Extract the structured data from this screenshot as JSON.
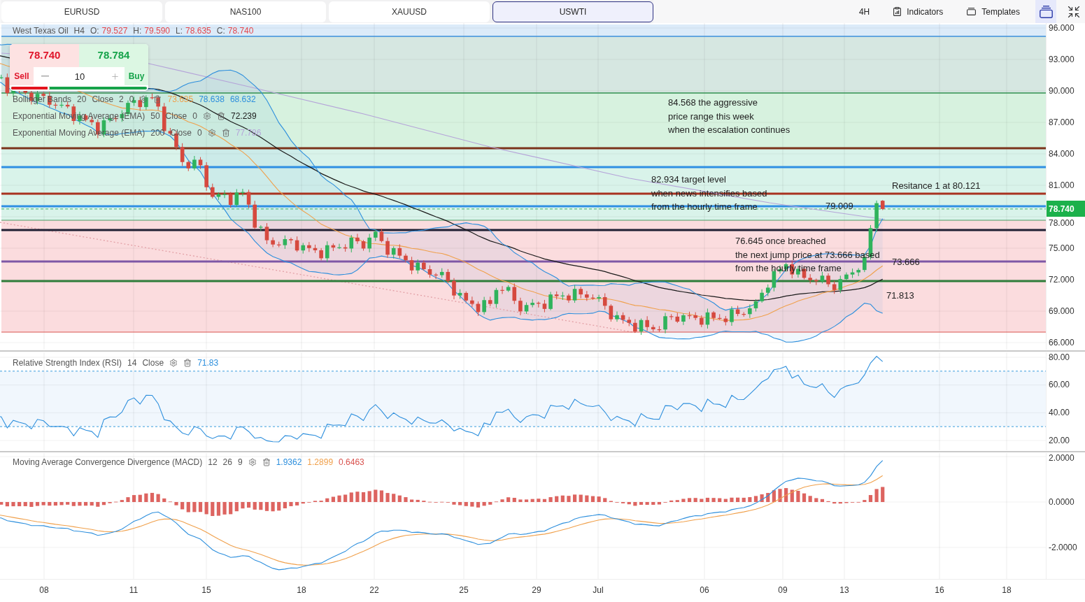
{
  "symbol_tabs": [
    {
      "label": "EURUSD",
      "selected": false
    },
    {
      "label": "NAS100",
      "selected": false
    },
    {
      "label": "XAUUSD",
      "selected": false
    },
    {
      "label": "USWTI",
      "selected": true
    }
  ],
  "toolbar": {
    "interval": "4H",
    "buttons": [
      {
        "kind": "indicators",
        "label": "Indicators"
      },
      {
        "kind": "templates",
        "label": "Templates"
      }
    ],
    "icon_buttons": [
      {
        "kind": "layers",
        "selected": true
      },
      {
        "kind": "collapse",
        "selected": false
      }
    ]
  },
  "instrument_legend": {
    "name": "West Texas Oil",
    "interval": "H4",
    "ohlc": [
      {
        "label": "O:",
        "value": "79.527"
      },
      {
        "label": "H:",
        "value": "79.590"
      },
      {
        "label": "L:",
        "value": "78.635"
      },
      {
        "label": "C:",
        "value": "78.740"
      }
    ]
  },
  "trade_panel": {
    "sell_price": "78.740",
    "buy_price": "78.784",
    "sell_label": "Sell",
    "buy_label": "Buy",
    "quantity": "10",
    "sentiment": {
      "level": 0.27
    }
  },
  "indicator_legends": [
    {
      "name": "Bollinger Bands",
      "params": [
        "20",
        "Close",
        "2",
        "0"
      ],
      "values": [
        {
          "text": "73.635",
          "color": "#f0a04b"
        },
        {
          "text": "78.638",
          "color": "#2d8fdd"
        },
        {
          "text": "68.632",
          "color": "#2d8fdd"
        }
      ]
    },
    {
      "name": "Exponential Moving Average (EMA)",
      "params": [
        "50",
        "Close",
        "0"
      ],
      "values": [
        {
          "text": "72.239",
          "color": "#1a1a1a"
        }
      ]
    },
    {
      "name": "Exponential Moving Average (EMA)",
      "params": [
        "200",
        "Close",
        "0"
      ],
      "values": [
        {
          "text": "77.786",
          "color": "#b5a4d9"
        }
      ]
    }
  ],
  "annotations": [
    {
      "lines": [
        "84.568 the aggressive",
        "price range this week",
        "when the escalation continues"
      ]
    },
    {
      "lines": [
        "82.934 target level",
        "when news intensifies based",
        "from the hourly time frame"
      ]
    },
    {
      "lines": [
        "79.009"
      ]
    },
    {
      "lines": [
        "Resitance 1 at 80.121"
      ]
    },
    {
      "lines": [
        "76.645 once breached",
        "the next jump price at 73.666 based",
        "from the hourly time frame"
      ]
    },
    {
      "lines": [
        "73.666"
      ]
    },
    {
      "lines": [
        "71.813"
      ]
    }
  ],
  "price_axis": {
    "labels": [
      "96.000",
      "93.000",
      "90.000",
      "87.000",
      "84.000",
      "81.000",
      "78.000",
      "75.000",
      "72.000",
      "69.000",
      "66.000"
    ],
    "last_price": "78.740"
  },
  "rsi_pane": {
    "legend": {
      "name": "Relative Strength Index (RSI)",
      "params": [
        "14",
        "Close"
      ],
      "values": [
        {
          "text": "71.83",
          "color": "#2d8fdd"
        }
      ]
    },
    "axis_labels": [
      "80.00",
      "60.00",
      "40.00",
      "20.00"
    ]
  },
  "macd_pane": {
    "legend": {
      "name": "Moving Average Convergence Divergence (MACD)",
      "params": [
        "12",
        "26",
        "9"
      ],
      "values": [
        {
          "text": "1.9362",
          "color": "#2d8fdd"
        },
        {
          "text": "1.2899",
          "color": "#f0a04b"
        },
        {
          "text": "0.6463",
          "color": "#d9534f"
        }
      ]
    },
    "axis_labels": [
      "2.0000",
      "0.0000",
      "-2.0000"
    ]
  },
  "time_axis": {
    "labels": [
      "08",
      "11",
      "15",
      "18",
      "22",
      "25",
      "29",
      "Jul",
      "06",
      "09",
      "13",
      "16",
      "18"
    ]
  }
}
